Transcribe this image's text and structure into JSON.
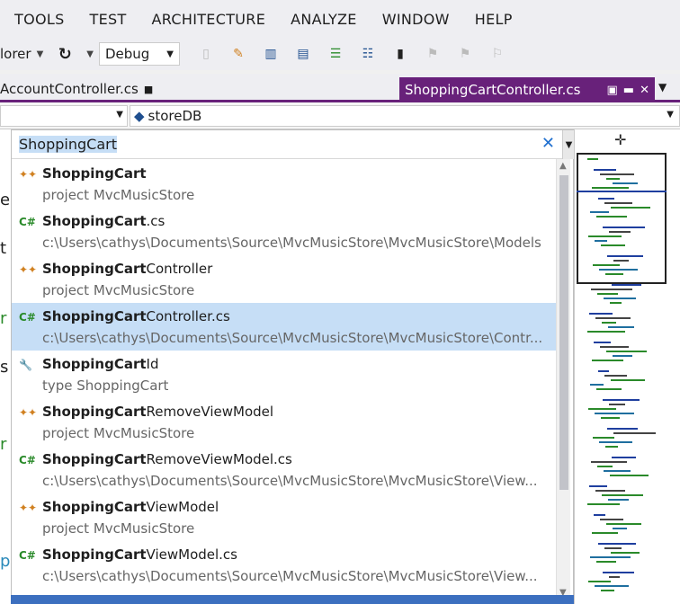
{
  "menu": [
    "TOOLS",
    "TEST",
    "ARCHITECTURE",
    "ANALYZE",
    "WINDOW",
    "HELP"
  ],
  "toolbar": {
    "left_label": "lorer",
    "config": "Debug"
  },
  "tabs": {
    "inactive": "AccountController.cs",
    "active": "ShoppingCartController.cs"
  },
  "navbar": {
    "member": "storeDB"
  },
  "search": {
    "query": "ShoppingCart"
  },
  "results": [
    {
      "kind": "project",
      "bold": "ShoppingCart",
      "rest": "",
      "sub": "project MvcMusicStore"
    },
    {
      "kind": "cs",
      "bold": "ShoppingCart",
      "rest": ".cs",
      "sub": "c:\\Users\\cathys\\Documents\\Source\\MvcMusicStore\\MvcMusicStore\\Models"
    },
    {
      "kind": "project",
      "bold": "ShoppingCart",
      "rest": "Controller",
      "sub": "project MvcMusicStore"
    },
    {
      "kind": "cs",
      "bold": "ShoppingCart",
      "rest": "Controller.cs",
      "sub": "c:\\Users\\cathys\\Documents\\Source\\MvcMusicStore\\MvcMusicStore\\Contr...",
      "selected": true
    },
    {
      "kind": "type",
      "bold": "ShoppingCart",
      "rest": "Id",
      "sub": "type ShoppingCart"
    },
    {
      "kind": "project",
      "bold": "ShoppingCart",
      "rest": "RemoveViewModel",
      "sub": "project MvcMusicStore"
    },
    {
      "kind": "cs",
      "bold": "ShoppingCart",
      "rest": "RemoveViewModel.cs",
      "sub": "c:\\Users\\cathys\\Documents\\Source\\MvcMusicStore\\MvcMusicStore\\View..."
    },
    {
      "kind": "project",
      "bold": "ShoppingCart",
      "rest": "ViewModel",
      "sub": "project MvcMusicStore"
    },
    {
      "kind": "cs",
      "bold": "ShoppingCart",
      "rest": "ViewModel.cs",
      "sub": "c:\\Users\\cathys\\Documents\\Source\\MvcMusicStore\\MvcMusicStore\\View..."
    }
  ],
  "icons": {
    "project": "class-icon",
    "cs": "csharp-file-icon",
    "type": "property-icon"
  }
}
